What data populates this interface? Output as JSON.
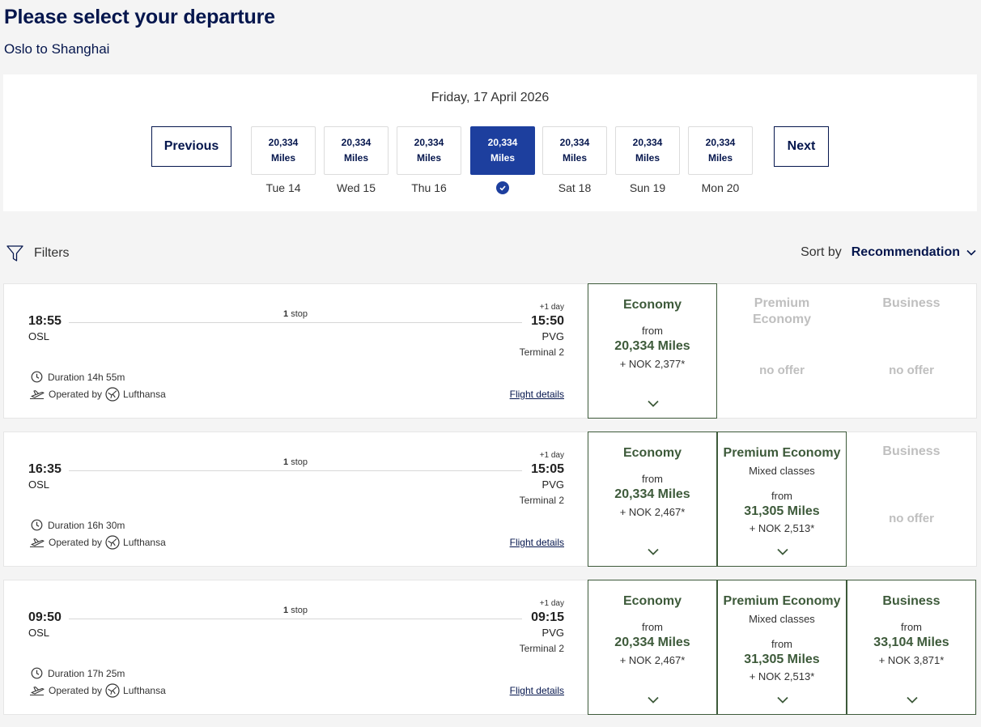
{
  "header": {
    "title": "Please select your departure",
    "route": "Oslo to Shanghai"
  },
  "date_selector": {
    "date": "Friday, 17 April 2026",
    "previous_label": "Previous",
    "next_label": "Next",
    "days": [
      {
        "miles": "20,334",
        "unit": "Miles",
        "label": "Tue 14",
        "selected": false
      },
      {
        "miles": "20,334",
        "unit": "Miles",
        "label": "Wed 15",
        "selected": false
      },
      {
        "miles": "20,334",
        "unit": "Miles",
        "label": "Thu 16",
        "selected": false
      },
      {
        "miles": "20,334",
        "unit": "Miles",
        "label": "",
        "selected": true
      },
      {
        "miles": "20,334",
        "unit": "Miles",
        "label": "Sat 18",
        "selected": false
      },
      {
        "miles": "20,334",
        "unit": "Miles",
        "label": "Sun 19",
        "selected": false
      },
      {
        "miles": "20,334",
        "unit": "Miles",
        "label": "Mon 20",
        "selected": false
      }
    ]
  },
  "toolbar": {
    "filters_label": "Filters",
    "sort_label": "Sort by",
    "sort_value": "Recommendation"
  },
  "flights": [
    {
      "dep_time": "18:55",
      "dep_code": "OSL",
      "arr_time": "15:50",
      "arr_code": "PVG",
      "plus_day": "+1 day",
      "terminal": "Terminal 2",
      "stops_count": "1",
      "stops_word": "stop",
      "duration": "Duration 14h 55m",
      "operated_by": "Operated by",
      "airline": "Lufthansa",
      "details_label": "Flight details",
      "fares": [
        {
          "name": "Economy",
          "available": true,
          "sub": "",
          "from": "from",
          "miles": "20,334 Miles",
          "nok": "+ NOK 2,377*"
        },
        {
          "name": "Premium Economy",
          "available": false,
          "no_offer": "no offer"
        },
        {
          "name": "Business",
          "available": false,
          "no_offer": "no offer"
        }
      ]
    },
    {
      "dep_time": "16:35",
      "dep_code": "OSL",
      "arr_time": "15:05",
      "arr_code": "PVG",
      "plus_day": "+1 day",
      "terminal": "Terminal 2",
      "stops_count": "1",
      "stops_word": "stop",
      "duration": "Duration 16h 30m",
      "operated_by": "Operated by",
      "airline": "Lufthansa",
      "details_label": "Flight details",
      "fares": [
        {
          "name": "Economy",
          "available": true,
          "sub": "",
          "from": "from",
          "miles": "20,334 Miles",
          "nok": "+ NOK 2,467*"
        },
        {
          "name": "Premium Economy",
          "available": true,
          "sub": "Mixed classes",
          "from": "from",
          "miles": "31,305 Miles",
          "nok": "+ NOK 2,513*"
        },
        {
          "name": "Business",
          "available": false,
          "no_offer": "no offer"
        }
      ]
    },
    {
      "dep_time": "09:50",
      "dep_code": "OSL",
      "arr_time": "09:15",
      "arr_code": "PVG",
      "plus_day": "+1 day",
      "terminal": "Terminal 2",
      "stops_count": "1",
      "stops_word": "stop",
      "duration": "Duration 17h 25m",
      "operated_by": "Operated by",
      "airline": "Lufthansa",
      "details_label": "Flight details",
      "fares": [
        {
          "name": "Economy",
          "available": true,
          "sub": "",
          "from": "from",
          "miles": "20,334 Miles",
          "nok": "+ NOK 2,467*"
        },
        {
          "name": "Premium Economy",
          "available": true,
          "sub": "Mixed classes",
          "from": "from",
          "miles": "31,305 Miles",
          "nok": "+ NOK 2,513*"
        },
        {
          "name": "Business",
          "available": true,
          "sub": "",
          "from": "from",
          "miles": "33,104 Miles",
          "nok": "+ NOK 3,871*"
        }
      ]
    }
  ],
  "colors": {
    "navy": "#05164d",
    "selected_blue": "#1d3f9e",
    "fare_green": "#3d5a3a",
    "disabled_grey": "#bfbfbf"
  }
}
